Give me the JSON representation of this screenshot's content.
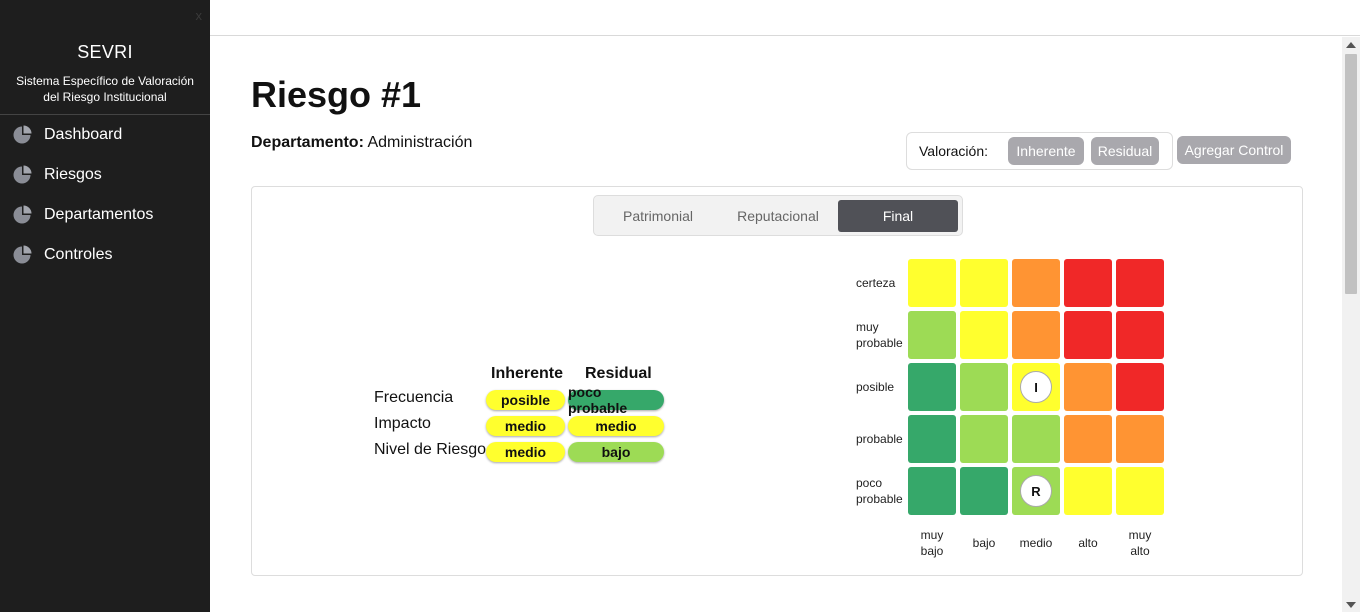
{
  "sidebar": {
    "close": "x",
    "title": "SEVRI",
    "subtitle": "Sistema Específico de Valoración del Riesgo Institucional",
    "items": [
      {
        "label": "Dashboard",
        "icon": "pie-chart-icon"
      },
      {
        "label": "Riesgos",
        "icon": "pie-chart-icon"
      },
      {
        "label": "Departamentos",
        "icon": "pie-chart-icon"
      },
      {
        "label": "Controles",
        "icon": "pie-chart-icon"
      }
    ]
  },
  "page": {
    "title": "Riesgo #1",
    "dept_label": "Departamento:",
    "dept_value": "Administración"
  },
  "valoracion": {
    "label": "Valoración:",
    "inherente": "Inherente",
    "residual": "Residual",
    "add_control": "Agregar Control"
  },
  "tabs": [
    {
      "label": "Patrimonial",
      "active": false
    },
    {
      "label": "Reputacional",
      "active": false
    },
    {
      "label": "Final",
      "active": true
    }
  ],
  "summary": {
    "col_inherente": "Inherente",
    "col_residual": "Residual",
    "rows": [
      {
        "label": "Frecuencia",
        "inherente": "posible",
        "residual": "poco probable",
        "inh_color": "#ffff2e",
        "res_color": "#36a86a"
      },
      {
        "label": "Impacto",
        "inherente": "medio",
        "residual": "medio",
        "inh_color": "#ffff2e",
        "res_color": "#ffff2e"
      },
      {
        "label": "Nivel de Riesgo",
        "inherente": "medio",
        "residual": "bajo",
        "inh_color": "#ffff2e",
        "res_color": "#9ddb55"
      }
    ]
  },
  "matrix": {
    "rows": [
      {
        "label": "certeza",
        "colors": [
          "#ffff2e",
          "#ffff2e",
          "#ff9433",
          "#f02828",
          "#f02828"
        ]
      },
      {
        "label": "muy probable",
        "colors": [
          "#9ddb55",
          "#ffff2e",
          "#ff9433",
          "#f02828",
          "#f02828"
        ]
      },
      {
        "label": "posible",
        "colors": [
          "#36a86a",
          "#9ddb55",
          "#ffff2e",
          "#ff9433",
          "#f02828"
        ]
      },
      {
        "label": "probable",
        "colors": [
          "#36a86a",
          "#9ddb55",
          "#9ddb55",
          "#ff9433",
          "#ff9433"
        ]
      },
      {
        "label": "poco probable",
        "colors": [
          "#36a86a",
          "#36a86a",
          "#9ddb55",
          "#ffff2e",
          "#ffff2e"
        ]
      }
    ],
    "columns": [
      "muy bajo",
      "bajo",
      "medio",
      "alto",
      "muy alto"
    ],
    "markers": [
      {
        "text": "I",
        "row": 2,
        "col": 2
      },
      {
        "text": "R",
        "row": 4,
        "col": 2
      }
    ]
  }
}
